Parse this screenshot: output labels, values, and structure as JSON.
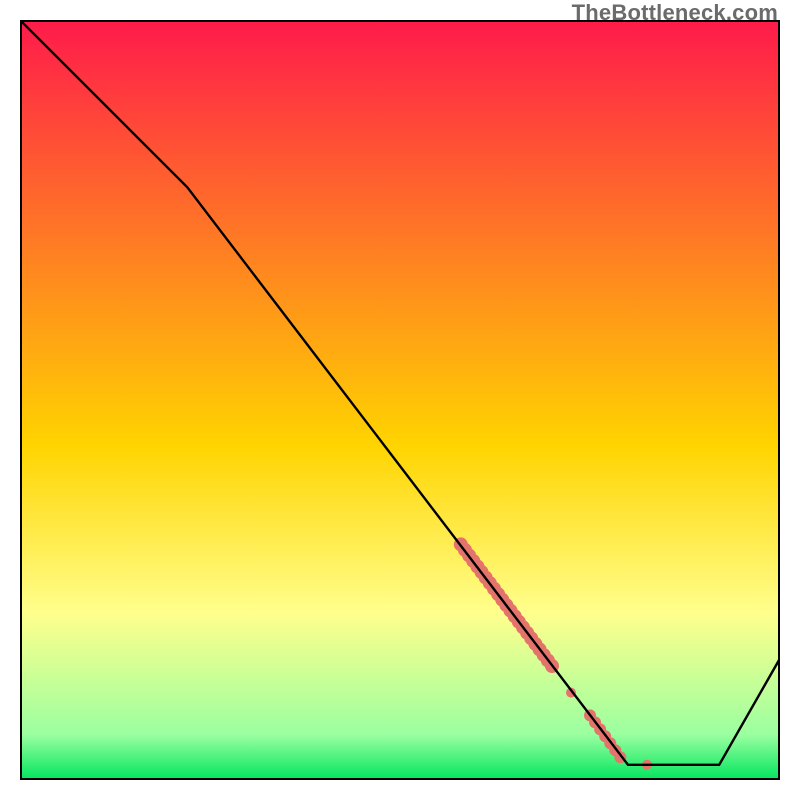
{
  "watermark": {
    "text": "TheBottleneck.com"
  },
  "chart_data": {
    "type": "line",
    "title": "",
    "xlabel": "",
    "ylabel": "",
    "xlim": [
      0,
      100
    ],
    "ylim": [
      0,
      100
    ],
    "background_gradient": {
      "top_color": "#ff1a4b",
      "mid_color": "#ffd400",
      "soft_yellow": "#ffff8c",
      "pale_green": "#9bffa0",
      "bottom_color": "#00e55e"
    },
    "series": [
      {
        "name": "bottleneck-curve",
        "color": "#000000",
        "points": [
          {
            "x": 0,
            "y": 100
          },
          {
            "x": 22,
            "y": 78
          },
          {
            "x": 80,
            "y": 2
          },
          {
            "x": 92,
            "y": 2
          },
          {
            "x": 100,
            "y": 16
          }
        ]
      }
    ],
    "highlight_segments": [
      {
        "name": "dense-highlight",
        "color": "#e4736c",
        "radius": 7,
        "points": [
          {
            "x": 58,
            "y": 31
          },
          {
            "x": 70,
            "y": 15
          }
        ],
        "step": 0.9
      },
      {
        "name": "mid-dot",
        "color": "#e4736c",
        "radius": 5,
        "points": [
          {
            "x": 72.5,
            "y": 11.5
          }
        ]
      },
      {
        "name": "lower-highlight",
        "color": "#e4736c",
        "radius": 6,
        "points": [
          {
            "x": 75,
            "y": 8.5
          },
          {
            "x": 79,
            "y": 3
          }
        ],
        "step": 1.1
      },
      {
        "name": "floor-dot",
        "color": "#e4736c",
        "radius": 5,
        "points": [
          {
            "x": 82.5,
            "y": 2
          }
        ]
      }
    ]
  }
}
